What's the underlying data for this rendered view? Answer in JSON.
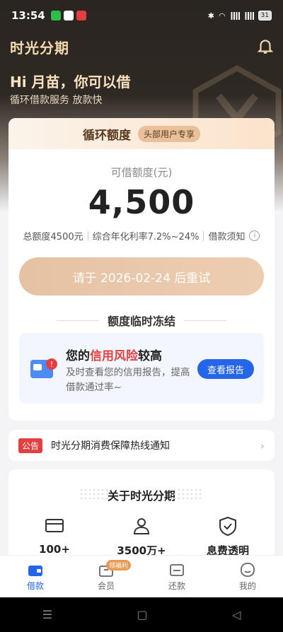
{
  "status_bar": {
    "time": "13:54",
    "battery": "31"
  },
  "header": {
    "brand": "时光分期",
    "greeting": "Hi 月苗，你可以借",
    "subtitle": "循环借款服务 放款快"
  },
  "credit_card": {
    "title": "循环额度",
    "tag": "头部用户专享",
    "available_label": "可借额度(元)",
    "available_amount": "4,500",
    "total_limit": "总额度4500元",
    "annual_rate": "综合年化利率7.2%~24%",
    "loan_notice": "借款须知",
    "retry_button": "请于 2026-02-24 后重试",
    "freeze_title": "额度临时冻结"
  },
  "risk_panel": {
    "title_prefix": "您的",
    "title_highlight": "信用风险",
    "title_suffix": "较高",
    "description": "及时查看您的信用报告，提高借款通过率~",
    "button": "查看报告"
  },
  "notice": {
    "badge": "公告",
    "text": "时光分期消费保障热线通知"
  },
  "about": {
    "title": "关于时光分期",
    "features": [
      {
        "icon": "card-icon",
        "value": "100+"
      },
      {
        "icon": "user-icon",
        "value": "3500万+"
      },
      {
        "icon": "shield-check-icon",
        "value": "息费透明"
      }
    ]
  },
  "bottom_nav": {
    "items": [
      {
        "label": "借款",
        "active": true
      },
      {
        "label": "会员",
        "badge": "领福利"
      },
      {
        "label": "还款"
      },
      {
        "label": "我的"
      }
    ]
  },
  "colors": {
    "accent": "#2566e8",
    "warn": "#e24040",
    "gold": "#f3d9b0"
  }
}
